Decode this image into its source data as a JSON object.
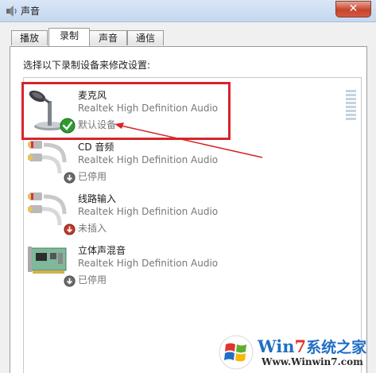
{
  "window": {
    "title": "声音",
    "close_glyph": "✕"
  },
  "tabs": [
    {
      "label": "播放"
    },
    {
      "label": "录制",
      "active": true
    },
    {
      "label": "声音"
    },
    {
      "label": "通信"
    }
  ],
  "instruction": "选择以下录制设备来修改设置:",
  "devices": [
    {
      "name": "麦克风",
      "driver": "Realtek High Definition Audio",
      "status": "默认设备",
      "icon": "microphone-icon",
      "badge": "default-check-icon"
    },
    {
      "name": "CD 音频",
      "driver": "Realtek High Definition Audio",
      "status": "已停用",
      "icon": "rca-cable-icon",
      "badge": "disabled-arrow-icon"
    },
    {
      "name": "线路输入",
      "driver": "Realtek High Definition Audio",
      "status": "未插入",
      "icon": "rca-cable-icon",
      "badge": "unplugged-arrow-icon"
    },
    {
      "name": "立体声混音",
      "driver": "Realtek High Definition Audio",
      "status": "已停用",
      "icon": "sound-card-icon",
      "badge": "disabled-arrow-icon"
    }
  ],
  "watermark": {
    "brand_w": "Win",
    "brand_7": "7",
    "brand_cn": "系统之家",
    "url": "Www.Winwin7.com"
  },
  "colors": {
    "annotation": "#d7242a",
    "check": "#2e9b2e",
    "brand_blue": "#1f6fc5",
    "brand_red": "#e0342a"
  }
}
